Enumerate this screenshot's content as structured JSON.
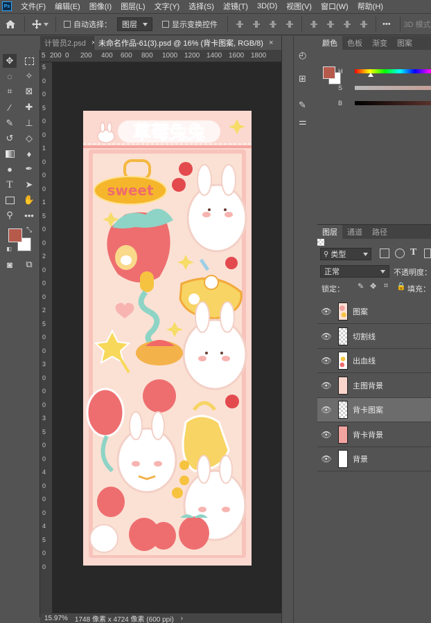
{
  "app": {
    "logo": "Ps"
  },
  "menu": [
    "文件(F)",
    "编辑(E)",
    "图像(I)",
    "图层(L)",
    "文字(Y)",
    "选择(S)",
    "滤镜(T)",
    "3D(D)",
    "视图(V)",
    "窗口(W)",
    "帮助(H)"
  ],
  "options": {
    "auto_select_label": "自动选择：",
    "auto_select_value": "图层",
    "show_transform_label": "显示变换控件",
    "more": "•••",
    "mode_3d": "3D 模式"
  },
  "tabs": [
    {
      "label": "计管员2.psd"
    },
    {
      "label": "未命名作品-61(3).psd @ 16% (背卡图案, RGB/8)"
    }
  ],
  "ruler": {
    "top": [
      "5",
      "200",
      "0",
      "200",
      "400",
      "600",
      "800",
      "1000",
      "1200",
      "1400",
      "1600",
      "1800"
    ],
    "left": [
      "5",
      "0",
      "0",
      "5",
      "0",
      "0",
      "1",
      "0",
      "0",
      "0",
      "1",
      "5",
      "0",
      "0",
      "2",
      "0",
      "0",
      "0",
      "2",
      "5",
      "0",
      "0",
      "3",
      "0",
      "0",
      "0",
      "3",
      "5",
      "0",
      "0",
      "4",
      "0",
      "0",
      "0",
      "4",
      "5",
      "0",
      "0"
    ]
  },
  "artwork": {
    "title": "草莓兔兔",
    "sweet": "sweet"
  },
  "status": {
    "zoom": "15.97%",
    "doc_size": "1748 像素 x 4724 像素 (600 ppi)",
    "arrow": "›"
  },
  "color_panel": {
    "tabs": [
      "颜色",
      "色板",
      "渐变",
      "图案"
    ],
    "h_label": "H",
    "s_label": "S",
    "b_label": "B",
    "foreground": "#b65a4c",
    "background": "#ffffff"
  },
  "layers_panel": {
    "tabs": [
      "图层",
      "通道",
      "路径"
    ],
    "filter_label": "类型",
    "blend_mode": "正常",
    "opacity_label": "不透明度：",
    "lock_label": "锁定：",
    "fill_label": "填充：",
    "layers": [
      {
        "name": "图案",
        "thumb": "pattern",
        "selected": false
      },
      {
        "name": "切割线",
        "thumb": "checker",
        "selected": false
      },
      {
        "name": "出血线",
        "thumb": "pattern2",
        "selected": false
      },
      {
        "name": "主图背景",
        "thumb": "#f9d6cc",
        "selected": false
      },
      {
        "name": "背卡图案",
        "thumb": "checker",
        "selected": true
      },
      {
        "name": "背卡背景",
        "thumb": "#f2a4a0",
        "selected": false
      },
      {
        "name": "背景",
        "thumb": "#ffffff",
        "selected": false
      }
    ]
  }
}
